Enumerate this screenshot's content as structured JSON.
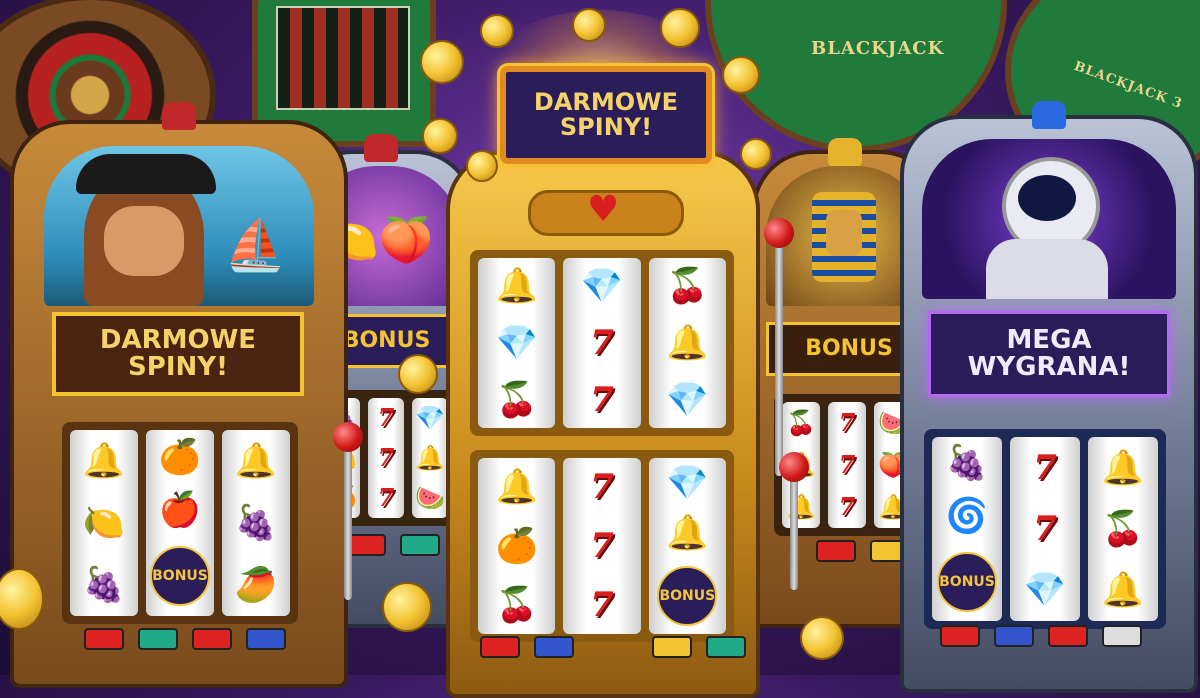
{
  "background": {
    "blackjack_label": "BLACKJACK",
    "blackjack_label_2": "BLACKJACK 3"
  },
  "center_machine": {
    "sign": "DARMOWE SPINY!",
    "reels_top": [
      [
        "🔔",
        "💎",
        "🍒"
      ],
      [
        "💎",
        "7",
        "7"
      ],
      [
        "🍒",
        "🔔",
        "💎"
      ]
    ],
    "reels_bottom": [
      [
        "🔔",
        "🍊",
        "🍒"
      ],
      [
        "7",
        "7",
        "7"
      ],
      [
        "💎",
        "🔔",
        "BONUS"
      ]
    ]
  },
  "left_machine": {
    "sign": "DARMOWE SPINY!",
    "reels": [
      [
        "🔔",
        "🍋",
        "🍇"
      ],
      [
        "🍊",
        "🍎",
        "BONUS"
      ],
      [
        "🔔",
        "🍇",
        "🥭"
      ]
    ]
  },
  "fruit_machine": {
    "sign": "BONUS",
    "reels": [
      [
        "🍇",
        "🍋",
        "🍊"
      ],
      [
        "7",
        "7",
        "7"
      ],
      [
        "💎",
        "🔔",
        "🍉"
      ]
    ]
  },
  "egypt_machine": {
    "sign": "BONUS",
    "reels": [
      [
        "🍒",
        "🔔",
        "🔔"
      ],
      [
        "7",
        "7",
        "7"
      ],
      [
        "🍉",
        "🍑",
        "🔔"
      ]
    ]
  },
  "space_machine": {
    "sign": "MEGA WYGRANA!",
    "reels": [
      [
        "🍇",
        "🌀",
        "BONUS"
      ],
      [
        "7",
        "7",
        "💎"
      ],
      [
        "🔔",
        "🍒",
        "🔔"
      ]
    ]
  },
  "colors": {
    "gold": "#f3c332",
    "red": "#d81e1e",
    "purple": "#3a1a62"
  }
}
